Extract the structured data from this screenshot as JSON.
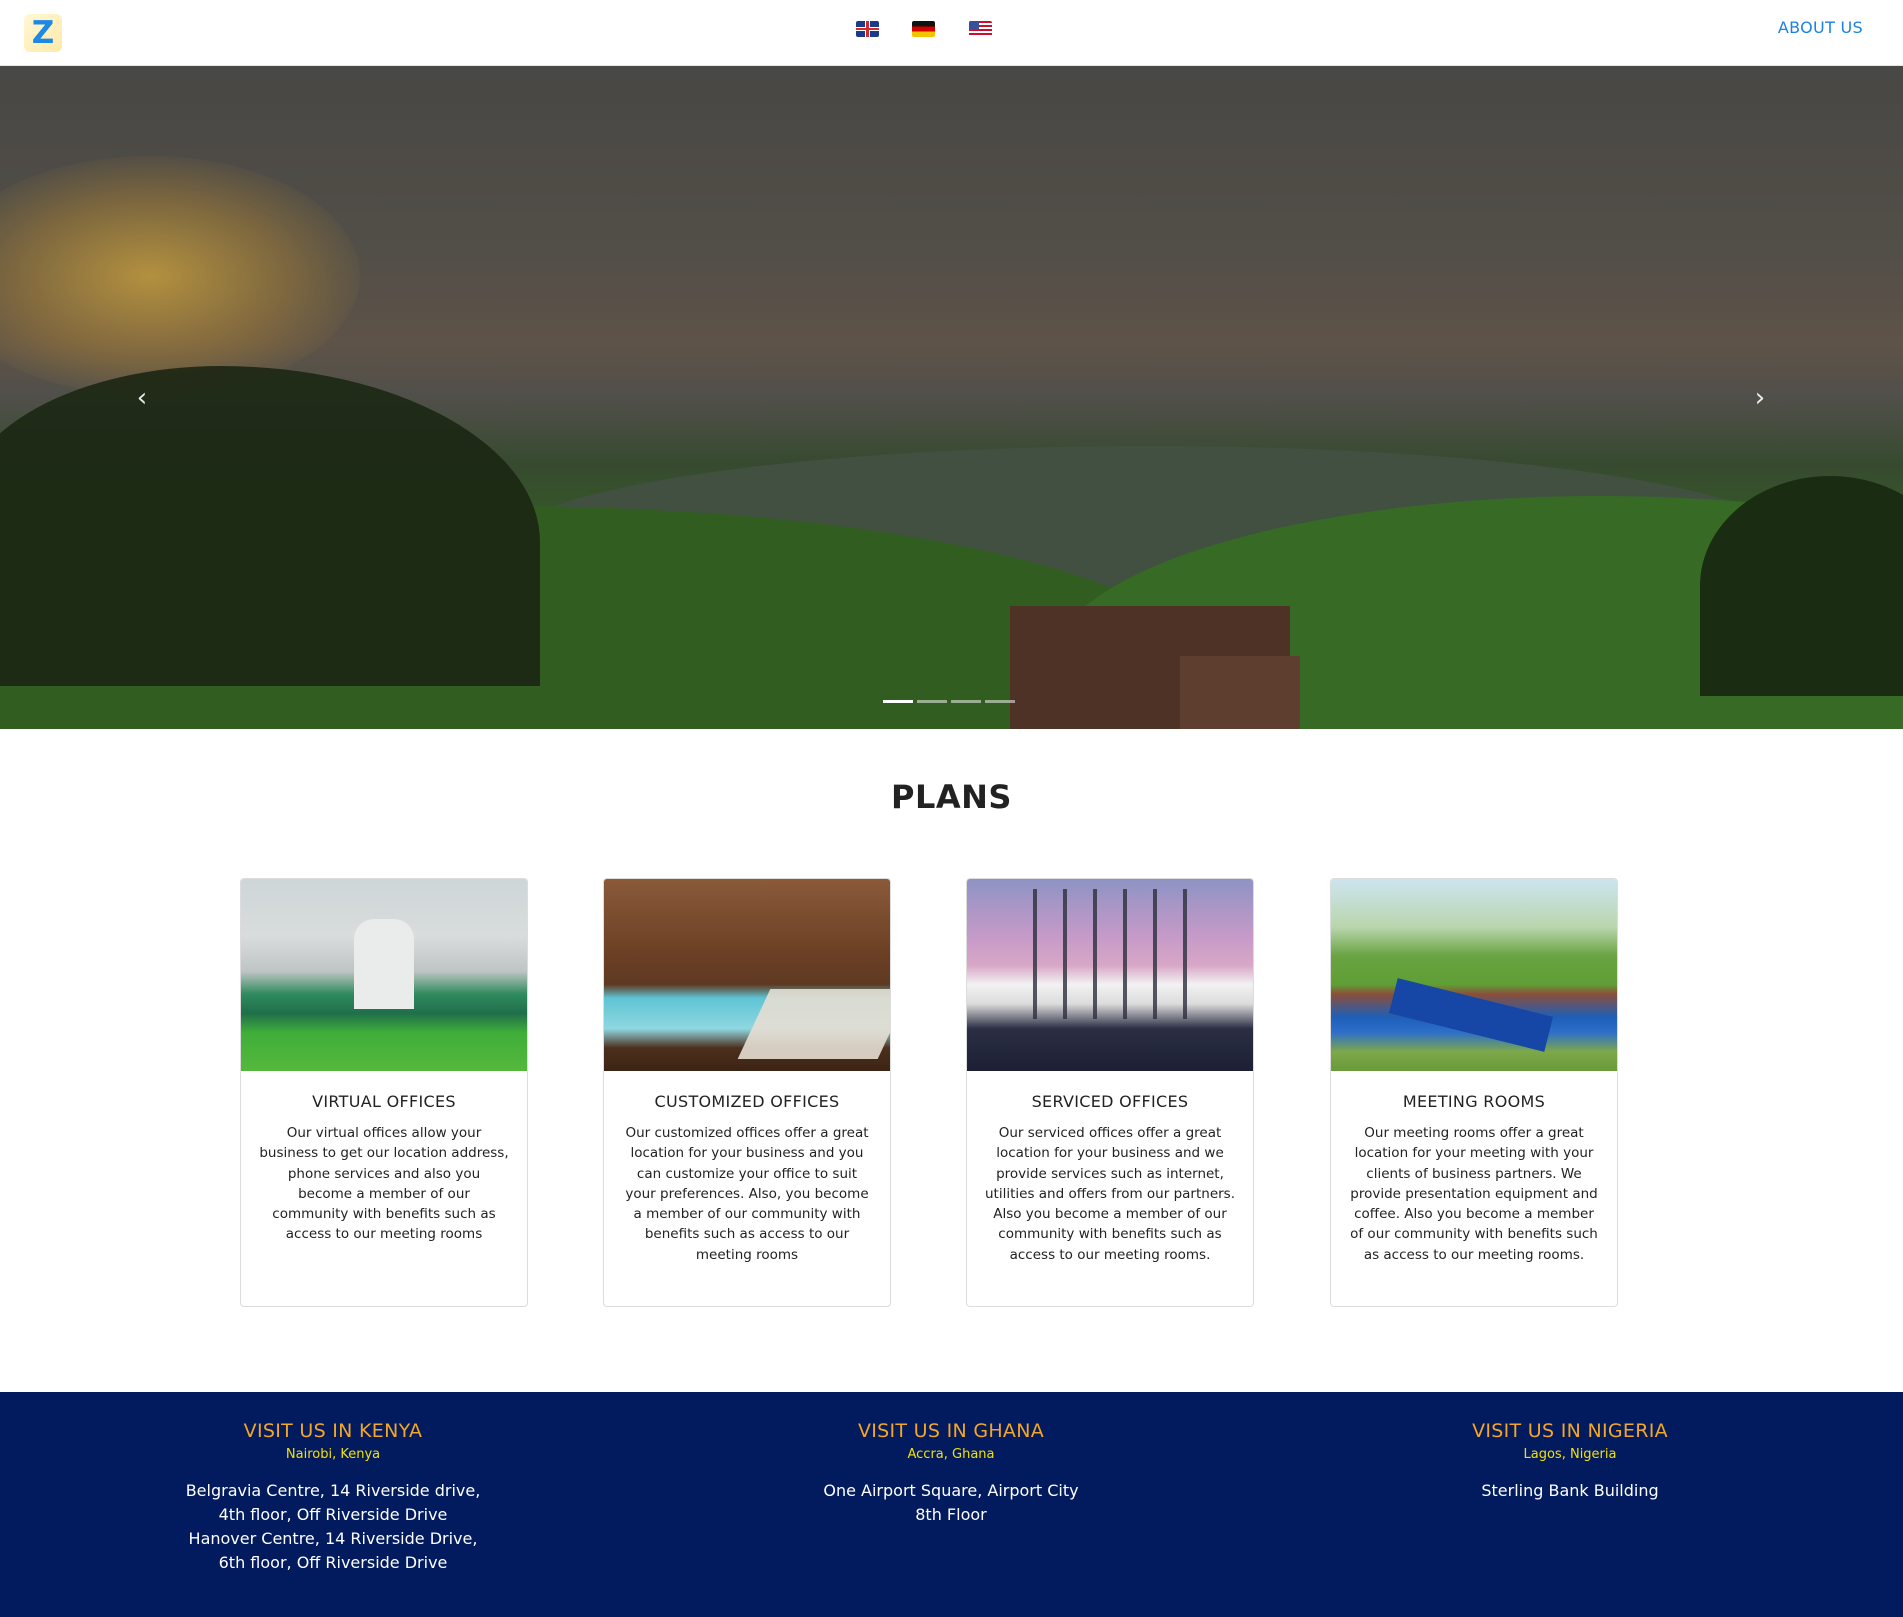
{
  "header": {
    "logo_letter": "Z",
    "flags": [
      "uk-flag-icon",
      "germany-flag-icon",
      "us-flag-icon"
    ],
    "nav_about": "ABOUT US"
  },
  "hero": {
    "prev_icon": "‹",
    "next_icon": "›",
    "slide_count": 4,
    "active_slide": 1
  },
  "plans": {
    "title": "PLANS",
    "cards": [
      {
        "title": "VIRTUAL OFFICES",
        "text": "Our virtual offices allow your business to get our location address, phone services and also you become a member of our community with benefits such as access to our meeting rooms"
      },
      {
        "title": "CUSTOMIZED OFFICES",
        "text": "Our customized offices offer a great location for your business and you can customize your office to suit your preferences. Also, you become a member of our community with benefits such as access to our meeting rooms"
      },
      {
        "title": "SERVICED OFFICES",
        "text": "Our serviced offices offer a great location for your business and we provide services such as internet, utilities and offers from our partners. Also you become a member of our community with benefits such as access to our meeting rooms."
      },
      {
        "title": "MEETING ROOMS",
        "text": "Our meeting rooms offer a great location for your meeting with your clients of business partners. We provide presentation equipment and coffee. Also you become a member of our community with benefits such as access to our meeting rooms."
      }
    ]
  },
  "footer": {
    "locations": [
      {
        "title": "VISIT US IN KENYA",
        "city": "Nairobi, Kenya",
        "address": "Belgravia Centre, 14 Riverside drive, 4th floor, Off Riverside Drive Hanover Centre, 14 Riverside Drive, 6th floor, Off Riverside Drive"
      },
      {
        "title": "VISIT US IN GHANA",
        "city": "Accra, Ghana",
        "address": "One Airport Square, Airport City 8th Floor"
      },
      {
        "title": "VISIT US IN NIGERIA",
        "city": "Lagos, Nigeria",
        "address": "Sterling Bank Building"
      }
    ]
  },
  "colors": {
    "link_blue": "#1a82e2",
    "footer_bg": "#021b5f",
    "footer_title": "#f5a623",
    "footer_city": "#f5e000"
  }
}
